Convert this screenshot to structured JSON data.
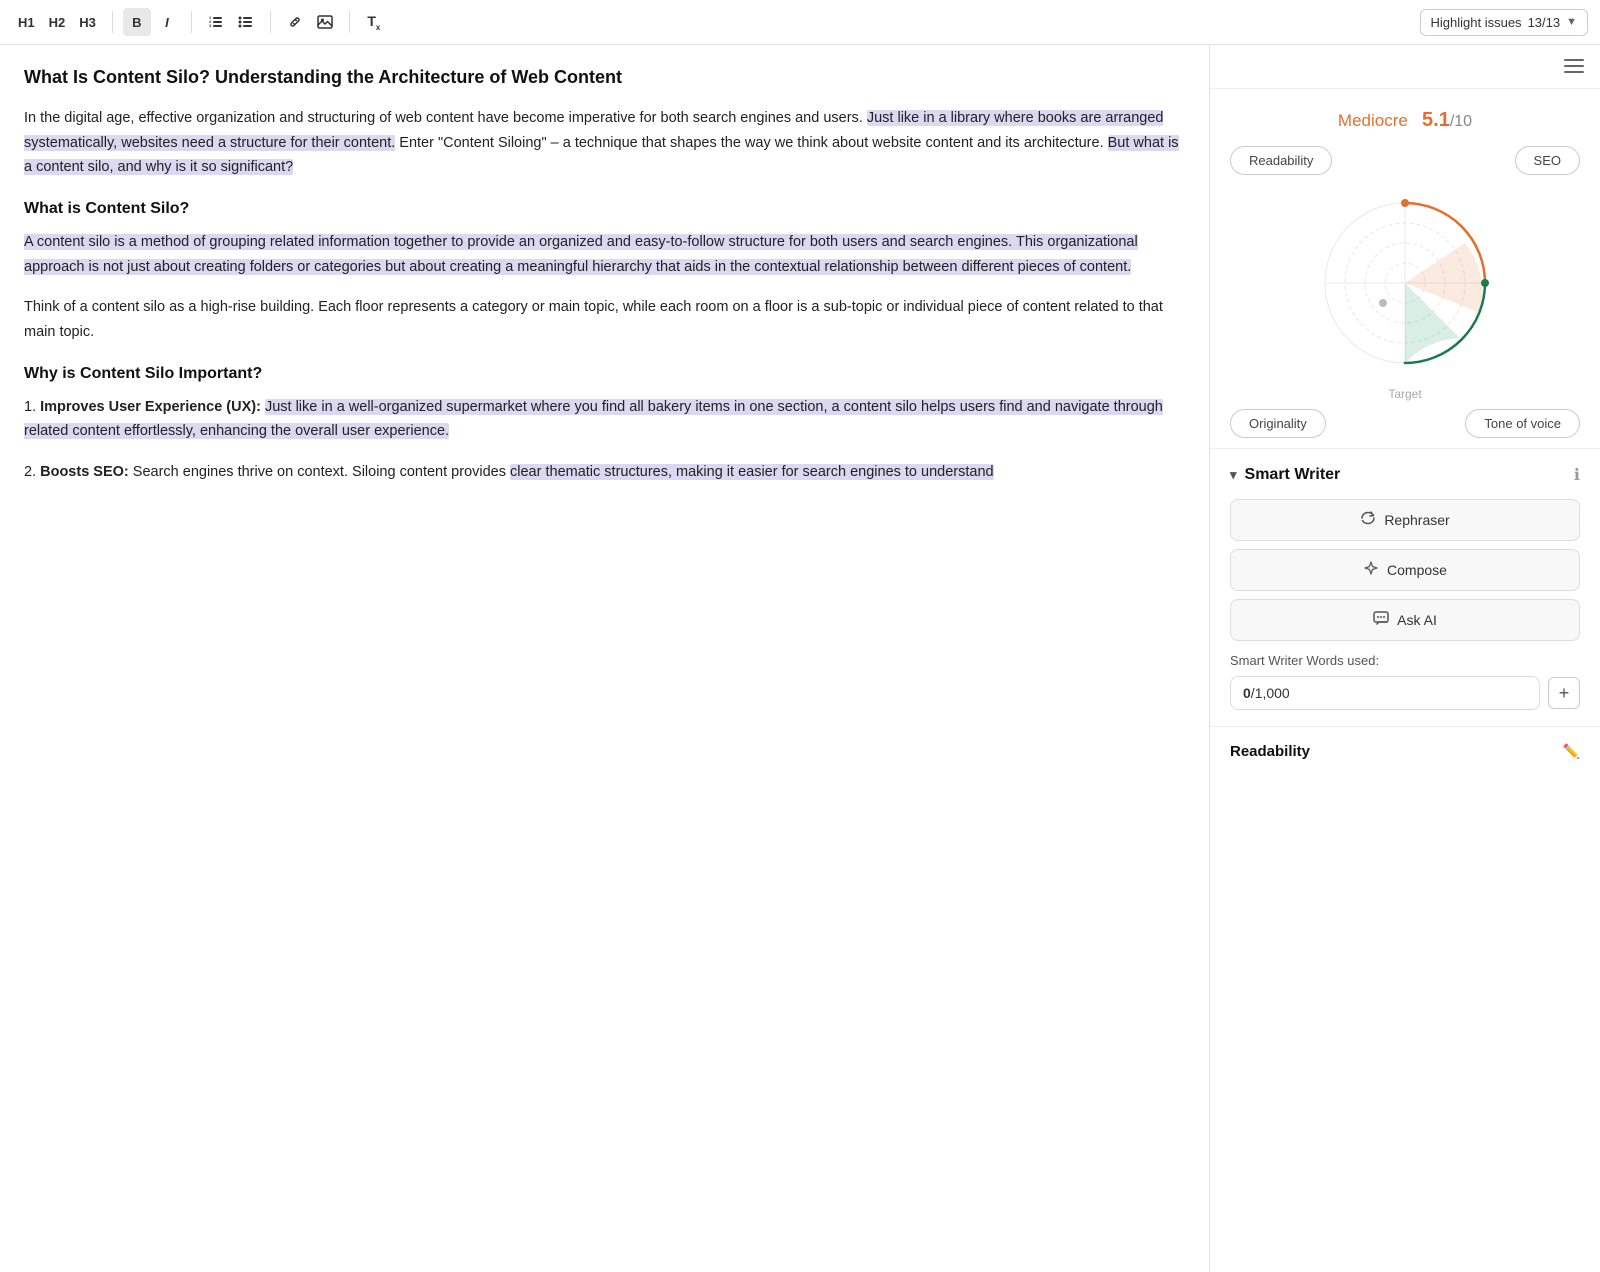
{
  "toolbar": {
    "h1_label": "H1",
    "h2_label": "H2",
    "h3_label": "H3",
    "bold_label": "B",
    "italic_label": "I",
    "ordered_list_label": "≡",
    "unordered_list_label": "≡",
    "link_label": "🔗",
    "image_label": "⬛",
    "clear_label": "Tx",
    "highlight_label": "Highlight issues",
    "highlight_count": "13/13"
  },
  "editor": {
    "title": "What Is Content Silo? Understanding the Architecture of Web Content",
    "paragraphs": [
      "In the digital age, effective organization and structuring of web content have become imperative for both search engines and users. Just like in a library where books are arranged systematically, websites need a structure for their content. Enter \"Content Siloing\" – a technique that shapes the way we think about website content and its architecture. But what is a content silo, and why is it so significant?",
      "A content silo is a method of grouping related information together to provide an organized and easy-to-follow structure for both users and search engines. This organizational approach is not just about creating folders or categories but about creating a meaningful hierarchy that aids in the contextual relationship between different pieces of content.",
      "Think of a content silo as a high-rise building. Each floor represents a category or main topic, while each room on a floor is a sub-topic or individual piece of content related to that main topic.",
      "1. Improves User Experience (UX): Just like in a well-organized supermarket where you find all bakery items in one section, a content silo helps users find and navigate through related content effortlessly, enhancing the overall user experience.",
      "2. Boosts SEO: Search engines thrive on context. Siloing content provides clear thematic structures, making it easier for search engines to understand"
    ],
    "h2_what": "What is Content Silo?",
    "h2_why": "Why is Content Silo Important?"
  },
  "sidebar": {
    "score_label": "Mediocre",
    "score_value": "5.1",
    "score_total": "/10",
    "tabs": {
      "readability": "Readability",
      "seo": "SEO",
      "originality": "Originality",
      "tone_of_voice": "Tone of voice"
    },
    "target_label": "Target",
    "smart_writer": {
      "title": "Smart Writer",
      "info_icon": "ℹ",
      "rephraser_label": "Rephraser",
      "compose_label": "Compose",
      "ask_ai_label": "Ask AI",
      "words_used_label": "Smart Writer Words used:",
      "words_count": "0",
      "words_limit": "1,000"
    },
    "readability": {
      "title": "Readability"
    }
  }
}
